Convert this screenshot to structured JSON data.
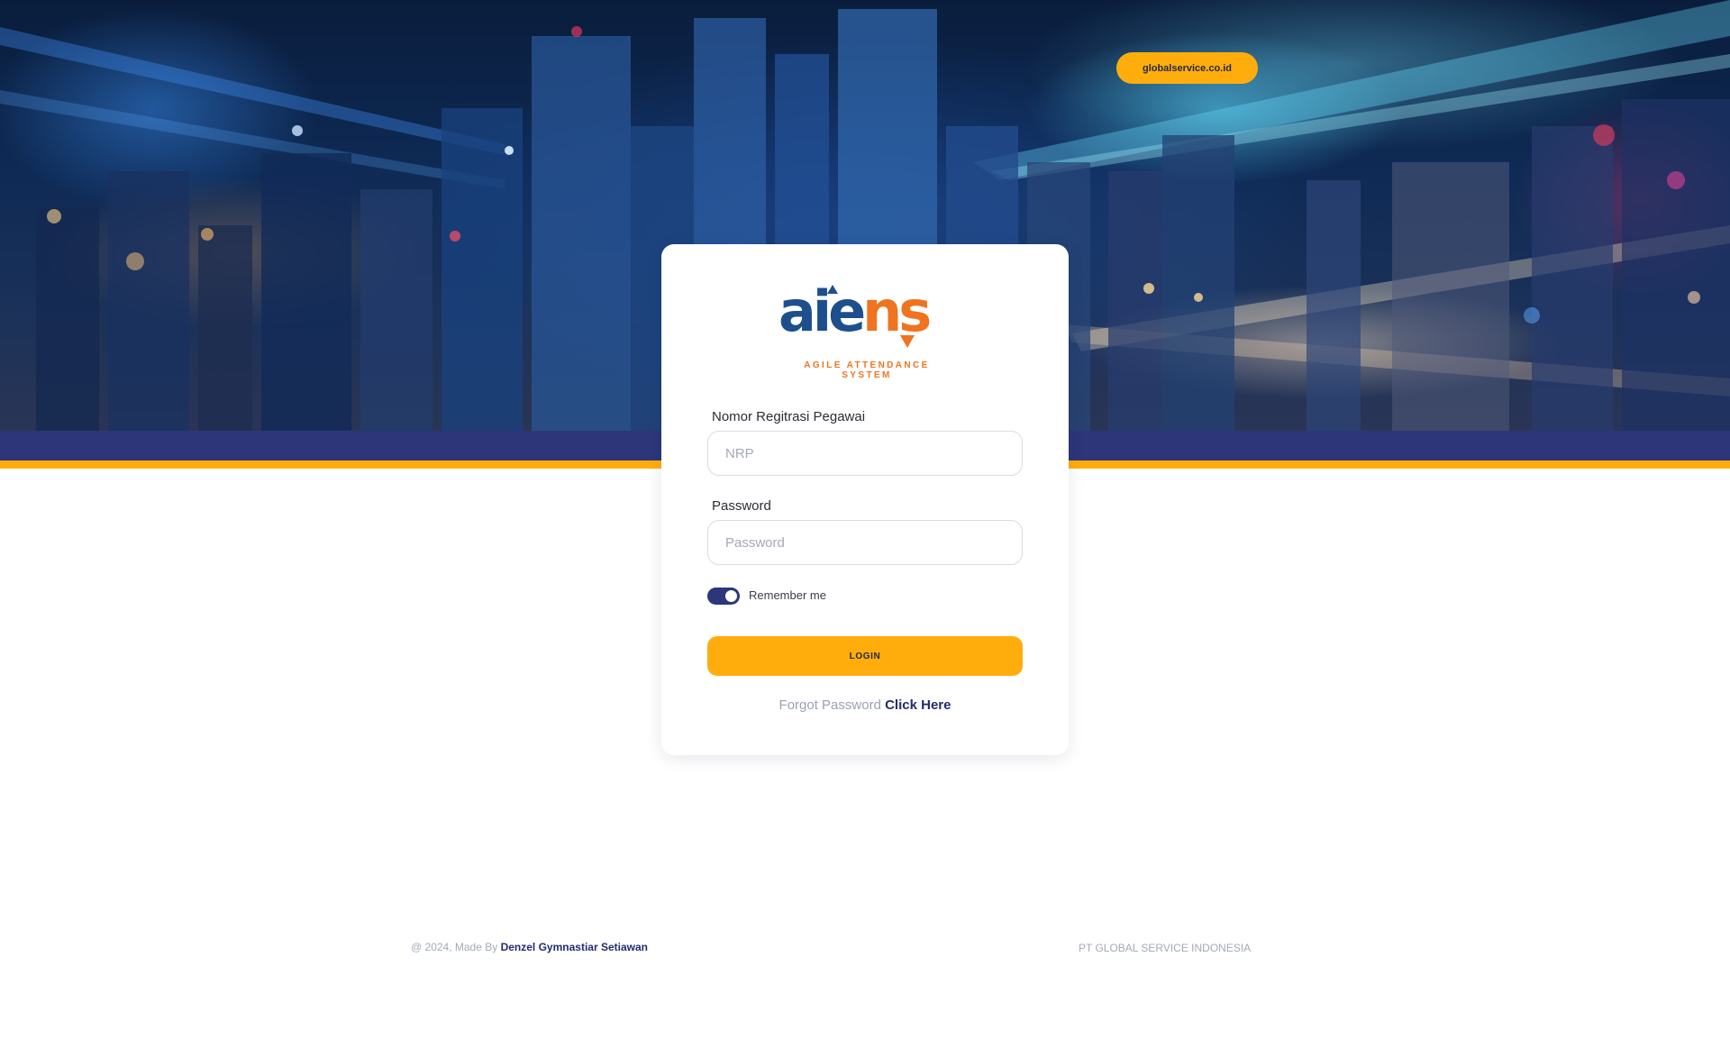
{
  "header": {
    "site_link_label": "globalservice.co.id"
  },
  "brand": {
    "logo_part1": "aie",
    "logo_part2": "ns",
    "tagline": "AGILE ATTENDANCE SYSTEM",
    "primary_color": "#1d4f8c",
    "secondary_color": "#f0741f"
  },
  "login_form": {
    "nrp_label": "Nomor Regitrasi Pegawai",
    "nrp_placeholder": "NRP",
    "nrp_value": "",
    "password_label": "Password",
    "password_placeholder": "Password",
    "password_value": "",
    "remember_label": "Remember me",
    "remember_checked": true,
    "login_button_label": "LOGIN",
    "forgot_text": "Forgot Password",
    "forgot_link_label": "Click Here"
  },
  "footer": {
    "left_prefix": "@ 2024, Made By",
    "author": "Denzel Gymnastiar Setiawan",
    "right_text": "PT GLOBAL SERVICE INDONESIA"
  },
  "colors": {
    "accent_yellow": "#ffad0d",
    "accent_navy": "#2d3679"
  },
  "icons": {
    "toggle": "toggle-switch-on"
  }
}
